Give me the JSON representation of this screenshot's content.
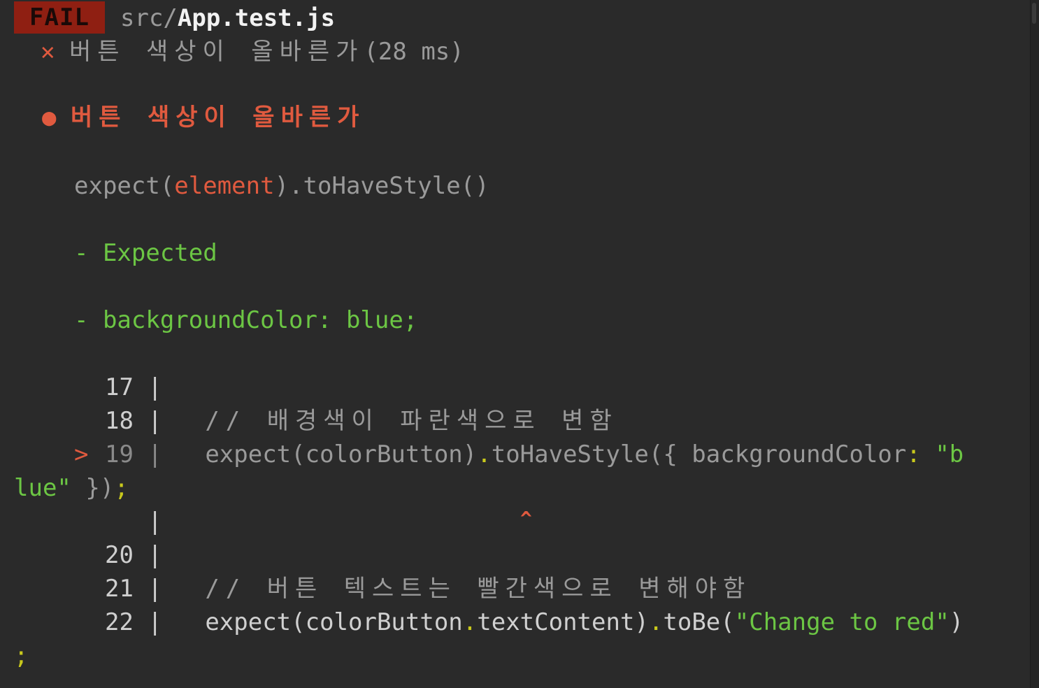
{
  "header": {
    "fail_label": "FAIL",
    "path_dir": "src/",
    "path_file": "App.test.js"
  },
  "test_result": {
    "mark": "✕",
    "name": "버튼 색상이 올바른가",
    "duration": "(28 ms)"
  },
  "failure": {
    "bullet": "●",
    "title": "버튼 색상이 올바른가",
    "expect_prefix": "expect(",
    "expect_arg": "element",
    "expect_suffix": ").toHaveStyle()",
    "diff_expected_label": "- Expected",
    "diff_line_prefix": "- ",
    "diff_line_value": "backgroundColor: blue;"
  },
  "code_frame": {
    "pointer": ">",
    "caret": "^",
    "lines": [
      {
        "num": "17",
        "text": ""
      },
      {
        "num": "18",
        "text": "// 배경색이 파란색으로 변함"
      },
      {
        "num": "19",
        "part1": "expect(colorButton)",
        "dot1": ".",
        "part2": "toHaveStyle({ backgroundColor",
        "colon": ":",
        "str1": " \"b",
        "wrap_str": "lue\"",
        "wrap_rest": " })",
        "semi": ";"
      },
      {
        "num": "20",
        "text": ""
      },
      {
        "num": "21",
        "text": "// 버튼 텍스트는 빨간색으로 변해야함"
      },
      {
        "num": "22",
        "part1": "expect(colorButton",
        "dot1": ".",
        "part2": "textContent)",
        "dot2": ".",
        "part3": "toBe(",
        "str": "\"Change to red\"",
        "close": ")",
        "semi": ";"
      }
    ]
  },
  "colors": {
    "background": "#2a2a2a",
    "fail_badge": "#8f1f12",
    "error_red": "#e05a3f",
    "diff_green": "#6cc644",
    "punct_yellow": "#c9c91c"
  }
}
